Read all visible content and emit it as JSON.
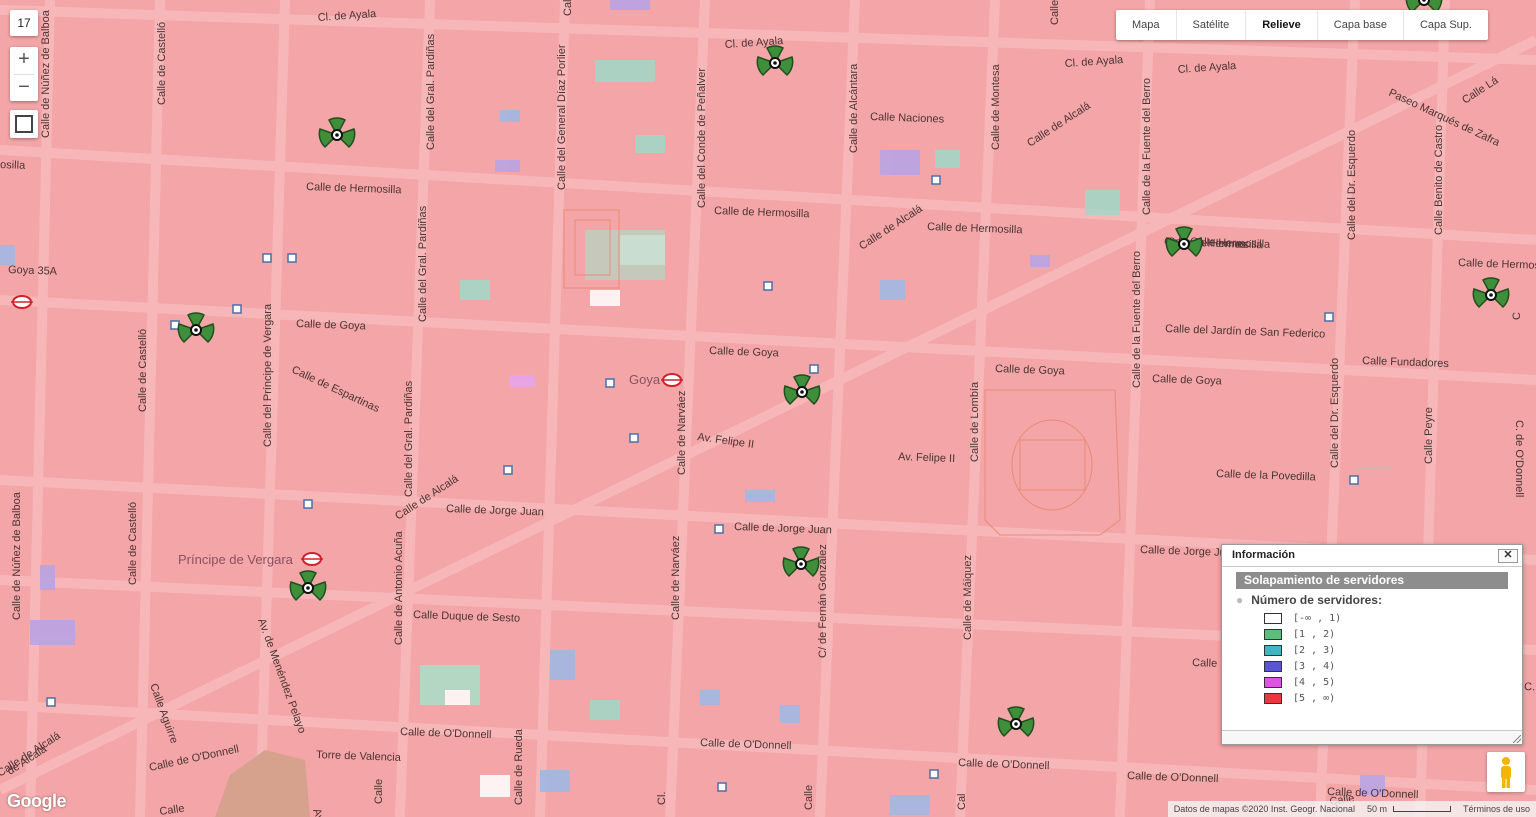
{
  "map": {
    "zoom_level": "17",
    "zoom_in": "+",
    "zoom_out": "−",
    "base_color": "#f3a5a7",
    "map_types": [
      {
        "label": "Mapa",
        "active": false
      },
      {
        "label": "Satélite",
        "active": false
      },
      {
        "label": "Relieve",
        "active": true
      },
      {
        "label": "Capa base",
        "active": false
      },
      {
        "label": "Capa Sup.",
        "active": false
      }
    ],
    "streets": [
      "Cl. de Ayala",
      "Cl. de Ayala",
      "Cl. de Ayala",
      "Cl. de Ayala",
      "Calle de Núñez de Balboa",
      "Calle de Castelló",
      "Calle del Gral. Pardiñas",
      "Calle del General Díaz Porlier",
      "Calle del Conde de Peñalver",
      "Calle de Alcántara",
      "Calle de Montesa",
      "Calle de la Fuente del Berro",
      "Calle del Dr. Esquerdo",
      "Paseo Marqués de Zafra",
      "Calle Benito de Castro",
      "Calle Naciones",
      "Calle de Hermosilla",
      "Calle de Hermosilla",
      "Calle de Hermosilla",
      "Calle de Hermosilla",
      "Calle de Hermosilla",
      "Calle de Alcalá",
      "Calle de Alcalá",
      "Calle de Alcalá",
      "Calle de Alcalá",
      "Calle del Gral. Pardiñas",
      "Calle del Príncipe de Vergara",
      "Calle de Goya",
      "Calle de Goya",
      "Calle de Goya",
      "Calle de Goya",
      "Calle de Espartinas",
      "Calle de Castelló",
      "Calle del Gral. Pardiñas",
      "Calle de Narváez",
      "Av. Felipe II",
      "Av. Felipe II",
      "Calle de Lombía",
      "Calle del Jardín de San Federico",
      "Calle de la Fuente del Berro",
      "Calle Fundadores",
      "Calle del Dr. Esquerdo",
      "Calle Peyre",
      "Calle de la Povedilla",
      "C. de O'Donnell",
      "Calle de Jorge Juan",
      "Calle de Jorge Juan",
      "Calle de Jorge Juan",
      "Calle de Núñez de Balboa",
      "Calle de Castelló",
      "Calle de Antonio Acuña",
      "Calle Duque de Sesto",
      "Calle de Narváez",
      "C/ de Fernán González",
      "Calle de Máiquez",
      "Av. de Menéndez Pelayo",
      "Calle Aguirre",
      "Calle de O'Donnell",
      "Calle de O'Donnell",
      "Calle de O'Donnell",
      "Calle de O'Donnell",
      "Calle de O'Donnell",
      "Calle de O'Donnell",
      "Torre de Valencia",
      "Calle de Rueda",
      "de Alcalá",
      "Av.",
      "Calle",
      "Calle de Hermos",
      "Calle Lá",
      "Calle Hermosilla",
      "osilla",
      "Goya 35A",
      "Calle",
      "Calle",
      "C.",
      "C",
      "Cal",
      "Calle",
      "Cl.",
      "Calle",
      "Calle",
      "Calle",
      "Calle",
      "Calle"
    ],
    "metro_stations": [
      "Goya",
      "Príncipe de Vergara"
    ],
    "antenna_count": 10
  },
  "info_panel": {
    "title": "Información",
    "close": "✕",
    "layer_name": "Solapamiento de servidores",
    "legend_heading": "Número de servidores:",
    "legend": [
      {
        "range": "[-∞ , 1)",
        "color": "#ffffff"
      },
      {
        "range": "[1 , 2)",
        "color": "#5cbe7a"
      },
      {
        "range": "[2 , 3)",
        "color": "#3fb6c4"
      },
      {
        "range": "[3 , 4)",
        "color": "#5a55d6"
      },
      {
        "range": "[4 , 5)",
        "color": "#e052e6"
      },
      {
        "range": "[5 , ∞)",
        "color": "#e8393e"
      }
    ]
  },
  "footer": {
    "logo": "Google",
    "attribution": "Datos de mapas ©2020 Inst. Geogr. Nacional",
    "scale": "50 m",
    "terms": "Términos de uso"
  }
}
